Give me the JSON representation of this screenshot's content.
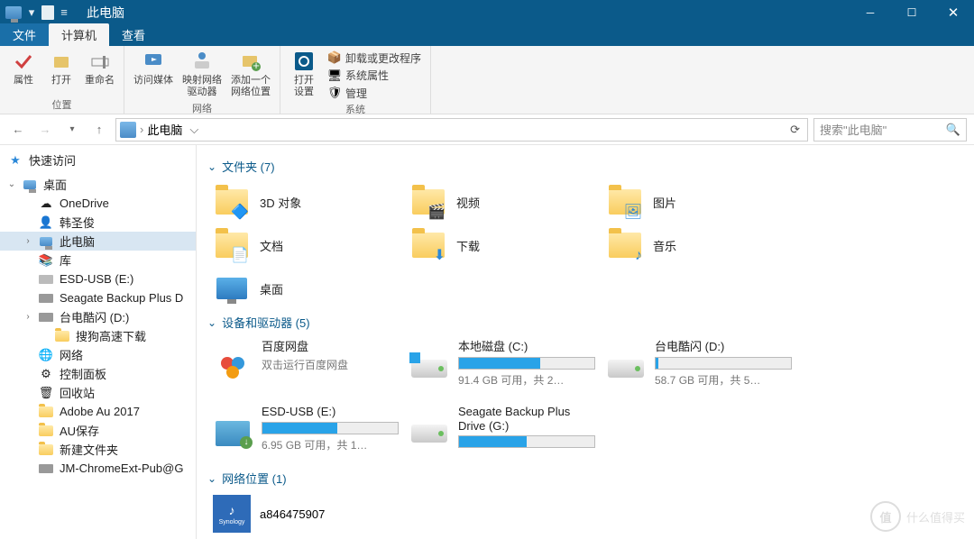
{
  "window": {
    "title": "此电脑"
  },
  "tabs": {
    "file": "文件",
    "computer": "计算机",
    "view": "查看"
  },
  "ribbon": {
    "location": {
      "properties": "属性",
      "open": "打开",
      "rename": "重命名",
      "label": "位置"
    },
    "network": {
      "media": "访问媒体",
      "driver": "映射网络\n驱动器",
      "addloc": "添加一个\n网络位置",
      "label": "网络"
    },
    "system": {
      "settings": "打开\n设置",
      "uninstall": "卸载或更改程序",
      "sysprops": "系统属性",
      "manage": "管理",
      "label": "系统"
    }
  },
  "breadcrumb": {
    "text": "此电脑"
  },
  "search": {
    "placeholder": "搜索\"此电脑\""
  },
  "sidebar": {
    "quick": "快速访问",
    "desktop": "桌面",
    "items": [
      "OneDrive",
      "韩圣俊",
      "此电脑",
      "库",
      "ESD-USB (E:)",
      "Seagate Backup Plus D",
      "台电酷闪 (D:)",
      "搜狗高速下载",
      "网络",
      "控制面板",
      "回收站",
      "Adobe Au 2017",
      "AU保存",
      "新建文件夹",
      "JM-ChromeExt-Pub@G"
    ]
  },
  "sections": {
    "folders": {
      "title": "文件夹 (7)",
      "items": [
        "3D 对象",
        "视频",
        "图片",
        "文档",
        "下载",
        "音乐",
        "桌面"
      ]
    },
    "drives": {
      "title": "设备和驱动器 (5)",
      "items": [
        {
          "name": "百度网盘",
          "sub": "双击运行百度网盘",
          "fill": 0
        },
        {
          "name": "本地磁盘 (C:)",
          "sub": "91.4 GB 可用，共 2…",
          "fill": 60
        },
        {
          "name": "台电酷闪 (D:)",
          "sub": "58.7 GB 可用，共 5…",
          "fill": 2
        },
        {
          "name": "ESD-USB (E:)",
          "sub": "6.95 GB 可用，共 1…",
          "fill": 55
        },
        {
          "name": "Seagate Backup Plus Drive (G:)",
          "sub": "",
          "fill": 50
        }
      ]
    },
    "netloc": {
      "title": "网络位置 (1)",
      "items": [
        "a846475907"
      ]
    }
  },
  "watermark": "什么值得买"
}
